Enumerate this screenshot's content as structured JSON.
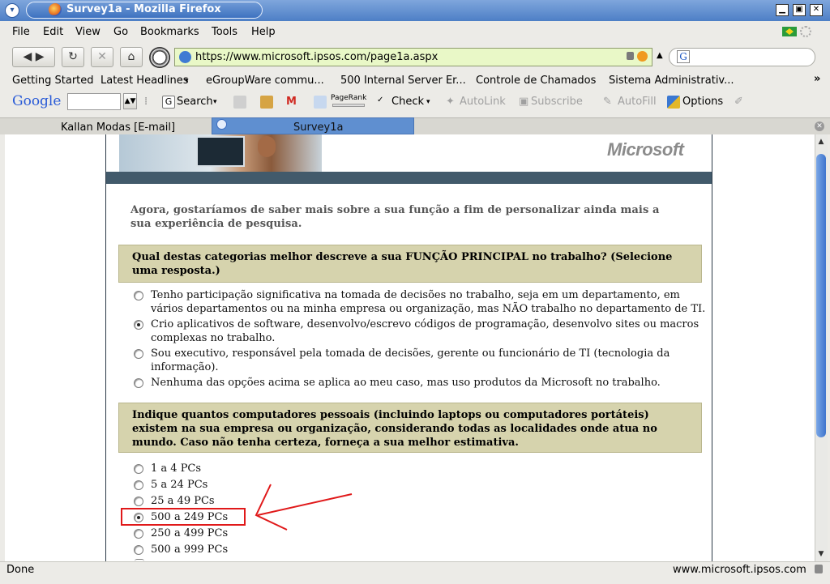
{
  "window": {
    "title": "Survey1a - Mozilla Firefox"
  },
  "menubar": {
    "items": [
      "File",
      "Edit",
      "View",
      "Go",
      "Bookmarks",
      "Tools",
      "Help"
    ]
  },
  "navbar": {
    "url": "https://www.microsoft.ipsos.com/page1a.aspx",
    "search_engine_glyph": "G"
  },
  "bookmarks": [
    "Getting Started",
    "Latest Headlines",
    "eGroupWare commu...",
    "500 Internal Server Er...",
    "Controle de Chamados",
    "Sistema Administrativ...",
    "»"
  ],
  "google_toolbar": {
    "logo": "Google",
    "search_label": "Search",
    "pagerank_label": "PageRank",
    "check_label": "Check",
    "autolink_label": "AutoLink",
    "subscribe_label": "Subscribe",
    "autofill_label": "AutoFill",
    "options_label": "Options"
  },
  "tabs": [
    {
      "label": "Kallan Modas [E-mail]",
      "active": false
    },
    {
      "label": "Survey1a",
      "active": true
    }
  ],
  "page": {
    "brand": "Microsoft",
    "intro": "Agora, gostaríamos de saber mais sobre a sua função a fim de personalizar ainda mais a sua experiência de pesquisa.",
    "question1": "Qual destas categorias melhor descreve a sua FUNÇÃO PRINCIPAL no trabalho? (Selecione uma resposta.)",
    "q1_options": [
      {
        "text": "Tenho participação significativa na tomada de decisões no trabalho, seja em um departamento, em vários departamentos ou na minha empresa ou organização, mas NÃO trabalho no departamento de TI.",
        "selected": false
      },
      {
        "text": "Crio aplicativos de software, desenvolvo/escrevo códigos de programação, desenvolvo sites ou macros complexas no trabalho.",
        "selected": true
      },
      {
        "text": "Sou executivo, responsável pela tomada de decisões, gerente ou funcionário de TI (tecnologia da informação).",
        "selected": false
      },
      {
        "text": "Nenhuma das opções acima se aplica ao meu caso, mas uso produtos da Microsoft no trabalho.",
        "selected": false
      }
    ],
    "question2": "Indique quantos computadores pessoais (incluindo laptops ou computadores portáteis) existem na sua empresa ou organização, considerando todas as localidades onde atua no mundo. Caso não tenha certeza, forneça a sua melhor estimativa.",
    "q2_options": [
      {
        "text": "1 a 4 PCs",
        "selected": false
      },
      {
        "text": "5 a 24 PCs",
        "selected": false
      },
      {
        "text": "25 a 49 PCs",
        "selected": false
      },
      {
        "text": "500 a 249 PCs",
        "selected": true
      },
      {
        "text": "250 a 499 PCs",
        "selected": false
      },
      {
        "text": "500 a 999 PCs",
        "selected": false
      }
    ]
  },
  "annotation_color": "#e0191a",
  "statusbar": {
    "left": "Done",
    "right": "www.microsoft.ipsos.com"
  }
}
